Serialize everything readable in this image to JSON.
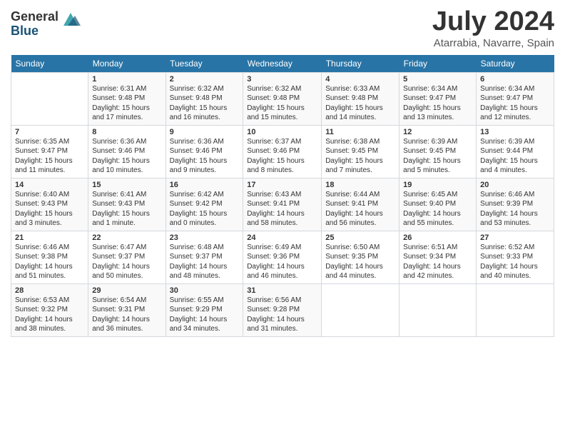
{
  "logo": {
    "general": "General",
    "blue": "Blue"
  },
  "title": "July 2024",
  "location": "Atarrabia, Navarre, Spain",
  "days_header": [
    "Sunday",
    "Monday",
    "Tuesday",
    "Wednesday",
    "Thursday",
    "Friday",
    "Saturday"
  ],
  "weeks": [
    [
      {
        "num": "",
        "text": ""
      },
      {
        "num": "1",
        "text": "Sunrise: 6:31 AM\nSunset: 9:48 PM\nDaylight: 15 hours\nand 17 minutes."
      },
      {
        "num": "2",
        "text": "Sunrise: 6:32 AM\nSunset: 9:48 PM\nDaylight: 15 hours\nand 16 minutes."
      },
      {
        "num": "3",
        "text": "Sunrise: 6:32 AM\nSunset: 9:48 PM\nDaylight: 15 hours\nand 15 minutes."
      },
      {
        "num": "4",
        "text": "Sunrise: 6:33 AM\nSunset: 9:48 PM\nDaylight: 15 hours\nand 14 minutes."
      },
      {
        "num": "5",
        "text": "Sunrise: 6:34 AM\nSunset: 9:47 PM\nDaylight: 15 hours\nand 13 minutes."
      },
      {
        "num": "6",
        "text": "Sunrise: 6:34 AM\nSunset: 9:47 PM\nDaylight: 15 hours\nand 12 minutes."
      }
    ],
    [
      {
        "num": "7",
        "text": "Sunrise: 6:35 AM\nSunset: 9:47 PM\nDaylight: 15 hours\nand 11 minutes."
      },
      {
        "num": "8",
        "text": "Sunrise: 6:36 AM\nSunset: 9:46 PM\nDaylight: 15 hours\nand 10 minutes."
      },
      {
        "num": "9",
        "text": "Sunrise: 6:36 AM\nSunset: 9:46 PM\nDaylight: 15 hours\nand 9 minutes."
      },
      {
        "num": "10",
        "text": "Sunrise: 6:37 AM\nSunset: 9:46 PM\nDaylight: 15 hours\nand 8 minutes."
      },
      {
        "num": "11",
        "text": "Sunrise: 6:38 AM\nSunset: 9:45 PM\nDaylight: 15 hours\nand 7 minutes."
      },
      {
        "num": "12",
        "text": "Sunrise: 6:39 AM\nSunset: 9:45 PM\nDaylight: 15 hours\nand 5 minutes."
      },
      {
        "num": "13",
        "text": "Sunrise: 6:39 AM\nSunset: 9:44 PM\nDaylight: 15 hours\nand 4 minutes."
      }
    ],
    [
      {
        "num": "14",
        "text": "Sunrise: 6:40 AM\nSunset: 9:43 PM\nDaylight: 15 hours\nand 3 minutes."
      },
      {
        "num": "15",
        "text": "Sunrise: 6:41 AM\nSunset: 9:43 PM\nDaylight: 15 hours\nand 1 minute."
      },
      {
        "num": "16",
        "text": "Sunrise: 6:42 AM\nSunset: 9:42 PM\nDaylight: 15 hours\nand 0 minutes."
      },
      {
        "num": "17",
        "text": "Sunrise: 6:43 AM\nSunset: 9:41 PM\nDaylight: 14 hours\nand 58 minutes."
      },
      {
        "num": "18",
        "text": "Sunrise: 6:44 AM\nSunset: 9:41 PM\nDaylight: 14 hours\nand 56 minutes."
      },
      {
        "num": "19",
        "text": "Sunrise: 6:45 AM\nSunset: 9:40 PM\nDaylight: 14 hours\nand 55 minutes."
      },
      {
        "num": "20",
        "text": "Sunrise: 6:46 AM\nSunset: 9:39 PM\nDaylight: 14 hours\nand 53 minutes."
      }
    ],
    [
      {
        "num": "21",
        "text": "Sunrise: 6:46 AM\nSunset: 9:38 PM\nDaylight: 14 hours\nand 51 minutes."
      },
      {
        "num": "22",
        "text": "Sunrise: 6:47 AM\nSunset: 9:37 PM\nDaylight: 14 hours\nand 50 minutes."
      },
      {
        "num": "23",
        "text": "Sunrise: 6:48 AM\nSunset: 9:37 PM\nDaylight: 14 hours\nand 48 minutes."
      },
      {
        "num": "24",
        "text": "Sunrise: 6:49 AM\nSunset: 9:36 PM\nDaylight: 14 hours\nand 46 minutes."
      },
      {
        "num": "25",
        "text": "Sunrise: 6:50 AM\nSunset: 9:35 PM\nDaylight: 14 hours\nand 44 minutes."
      },
      {
        "num": "26",
        "text": "Sunrise: 6:51 AM\nSunset: 9:34 PM\nDaylight: 14 hours\nand 42 minutes."
      },
      {
        "num": "27",
        "text": "Sunrise: 6:52 AM\nSunset: 9:33 PM\nDaylight: 14 hours\nand 40 minutes."
      }
    ],
    [
      {
        "num": "28",
        "text": "Sunrise: 6:53 AM\nSunset: 9:32 PM\nDaylight: 14 hours\nand 38 minutes."
      },
      {
        "num": "29",
        "text": "Sunrise: 6:54 AM\nSunset: 9:31 PM\nDaylight: 14 hours\nand 36 minutes."
      },
      {
        "num": "30",
        "text": "Sunrise: 6:55 AM\nSunset: 9:29 PM\nDaylight: 14 hours\nand 34 minutes."
      },
      {
        "num": "31",
        "text": "Sunrise: 6:56 AM\nSunset: 9:28 PM\nDaylight: 14 hours\nand 31 minutes."
      },
      {
        "num": "",
        "text": ""
      },
      {
        "num": "",
        "text": ""
      },
      {
        "num": "",
        "text": ""
      }
    ]
  ]
}
